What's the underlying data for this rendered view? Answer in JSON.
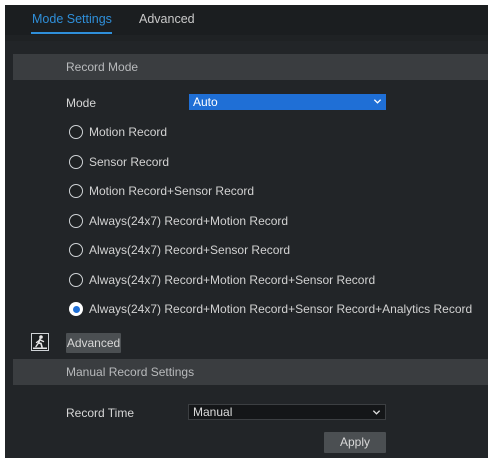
{
  "tabs": [
    {
      "label": "Mode Settings",
      "active": true
    },
    {
      "label": "Advanced",
      "active": false
    }
  ],
  "record_mode": {
    "section_title": "Record Mode",
    "mode_label": "Mode",
    "mode_value": "Auto",
    "options": [
      {
        "label": "Motion Record",
        "checked": false
      },
      {
        "label": "Sensor Record",
        "checked": false
      },
      {
        "label": "Motion Record+Sensor Record",
        "checked": false
      },
      {
        "label": "Always(24x7) Record+Motion Record",
        "checked": false
      },
      {
        "label": "Always(24x7) Record+Sensor Record",
        "checked": false
      },
      {
        "label": "Always(24x7) Record+Motion Record+Sensor Record",
        "checked": false
      },
      {
        "label": "Always(24x7) Record+Motion Record+Sensor Record+Analytics Record",
        "checked": true
      }
    ],
    "advanced_button": "Advanced"
  },
  "manual": {
    "section_title": "Manual Record Settings",
    "record_time_label": "Record Time",
    "record_time_value": "Manual",
    "apply_button": "Apply"
  },
  "icons": {
    "analytics": "person-analytics-icon",
    "dropdown": "chevron-down-icon"
  },
  "colors": {
    "accent": "#2f8fd9",
    "select_blue": "#1f6fd6",
    "background": "#222528",
    "section_header": "#3a3d40"
  }
}
